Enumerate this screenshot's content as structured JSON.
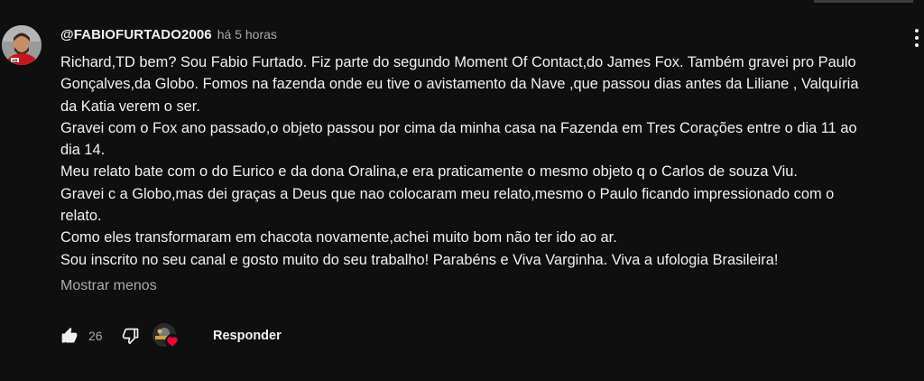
{
  "comment": {
    "author": "@FABIOFURTADO2006",
    "time": "há 5 horas",
    "lines": [
      "Richard,TD bem? Sou Fabio Furtado. Fiz parte do segundo Moment Of Contact,do James Fox. Também gravei pro Paulo",
      "Gonçalves,da Globo. Fomos na fazenda onde eu tive o avistamento da Nave ,que passou dias antes da Liliane , Valquíria",
      "da Katia verem o ser.",
      "Gravei com o Fox ano passado,o objeto passou por cima da minha casa na Fazenda em Tres Corações entre o dia 11 ao",
      "dia 14.",
      "Meu relato bate com o do Eurico e da dona Oralina,e era praticamente o mesmo objeto q o Carlos de souza Viu.",
      "Gravei c a Globo,mas dei graças a Deus que nao colocaram meu relato,mesmo o Paulo ficando impressionado com o",
      "relato.",
      "Como eles transformaram em chacota novamente,achei muito bom não ter ido ao ar.",
      "Sou inscrito no seu canal e gosto muito do seu trabalho! Parabéns e Viva Varginha. Viva a ufologia Brasileira!"
    ],
    "show_less": "Mostrar menos",
    "like_count": "26",
    "reply_label": "Responder"
  },
  "icons": {
    "like": "thumb-up-icon",
    "dislike": "thumb-down-icon",
    "heart": "creator-heart-icon",
    "menu": "more-vert-icon"
  },
  "colors": {
    "background": "#0f0f0f",
    "text": "#f1f1f1",
    "secondary_text": "#aaaaaa",
    "heart": "#ff0033"
  }
}
